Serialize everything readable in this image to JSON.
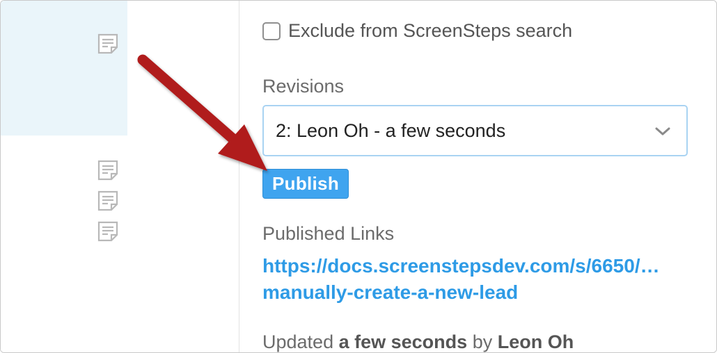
{
  "settings": {
    "exclude_label": "Exclude from ScreenSteps search",
    "exclude_checked": false
  },
  "revisions": {
    "label": "Revisions",
    "selected": "2: Leon Oh - a few seconds"
  },
  "publish_label": "Publish",
  "published_links": {
    "label": "Published Links",
    "link_line1": "https://docs.screenstepsdev.com/s/6650/…",
    "link_line2": "manually-create-a-new-lead"
  },
  "updated": {
    "prefix": "Updated",
    "when": "a few seconds",
    "by": "by",
    "author": "Leon Oh"
  },
  "icons": {
    "article": "document-icon",
    "chevron": "chevron-down-icon"
  },
  "colors": {
    "accent": "#3fa4ef",
    "link": "#2e9be6",
    "arrow": "#b01c1c",
    "highlight": "#eaf5fa"
  }
}
